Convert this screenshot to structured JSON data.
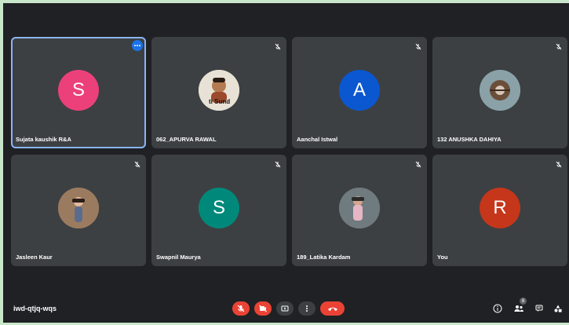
{
  "meeting": {
    "code": "iwd-qtjq-wqs"
  },
  "participants": [
    {
      "name": "Sujata kaushik R&A",
      "initial": "S",
      "avatar_color": "#ec407a",
      "type": "initial",
      "active": true,
      "muted": false
    },
    {
      "name": "062_APURVA RAWAL",
      "initial": "",
      "avatar_color": "#e8e2d6",
      "type": "photo",
      "photo_caption": "ti Sund",
      "muted": true
    },
    {
      "name": "Aanchal Istwal",
      "initial": "A",
      "avatar_color": "#0b57d0",
      "type": "initial",
      "muted": true
    },
    {
      "name": "132 ANUSHKA DAHIYA",
      "initial": "",
      "avatar_color": "#8aa1a8",
      "type": "photo",
      "muted": true
    },
    {
      "name": "Jasleen Kaur",
      "initial": "",
      "avatar_color": "#9b7b5f",
      "type": "photo",
      "muted": true
    },
    {
      "name": "Swapnil Maurya",
      "initial": "S",
      "avatar_color": "#00897b",
      "type": "initial",
      "muted": true
    },
    {
      "name": "189_Latika Kardam",
      "initial": "",
      "avatar_color": "#6f7b7e",
      "type": "photo",
      "muted": true
    },
    {
      "name": "You",
      "initial": "R",
      "avatar_color": "#c5361a",
      "type": "initial",
      "muted": true
    }
  ],
  "controls": {
    "mic": "mic-off-icon",
    "camera": "camera-off-icon",
    "present": "present-screen-icon",
    "more": "more-options-icon",
    "leave": "leave-call-icon"
  },
  "right_panel": {
    "info": "info-icon",
    "people": "people-icon",
    "people_count": "8",
    "chat": "chat-icon",
    "activities": "activities-icon"
  },
  "colors": {
    "background": "#202124",
    "tile": "#3c4043",
    "active_border": "#8ab4f8",
    "danger": "#ea4335"
  }
}
